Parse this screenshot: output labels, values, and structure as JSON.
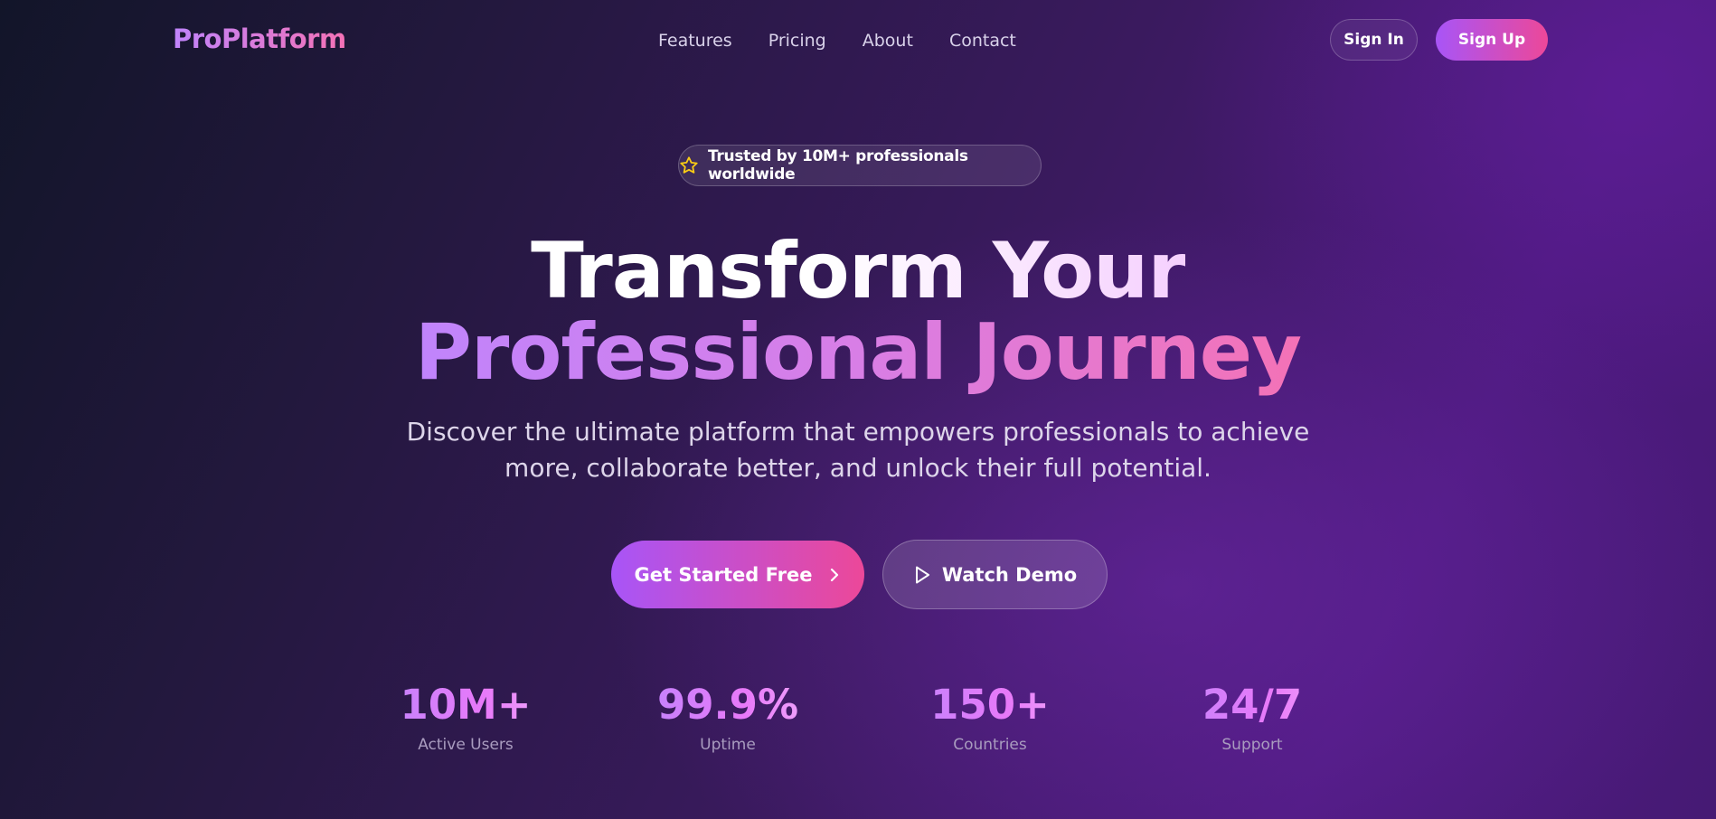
{
  "nav": {
    "logo": "ProPlatform",
    "links": [
      "Features",
      "Pricing",
      "About",
      "Contact"
    ],
    "sign_in": "Sign In",
    "sign_up": "Sign Up"
  },
  "hero": {
    "badge_icon": "star-icon",
    "badge_text": "Trusted by 10M+ professionals worldwide",
    "headline_line1": "Transform Your",
    "headline_line2": "Professional Journey",
    "subtitle": "Discover the ultimate platform that empowers professionals to achieve more, collaborate better, and unlock their full potential.",
    "cta_primary": "Get Started Free",
    "cta_primary_icon": "chevron-right-icon",
    "cta_secondary": "Watch Demo",
    "cta_secondary_icon": "play-icon"
  },
  "stats": [
    {
      "value": "10M+",
      "label": "Active Users"
    },
    {
      "value": "99.9%",
      "label": "Uptime"
    },
    {
      "value": "150+",
      "label": "Countries"
    },
    {
      "value": "24/7",
      "label": "Support"
    }
  ],
  "colors": {
    "accent_purple": "#a855f7",
    "accent_pink": "#ec4899",
    "star_yellow": "#facc15",
    "background_dark": "#1a1733",
    "background_purple": "#4e1a80"
  }
}
